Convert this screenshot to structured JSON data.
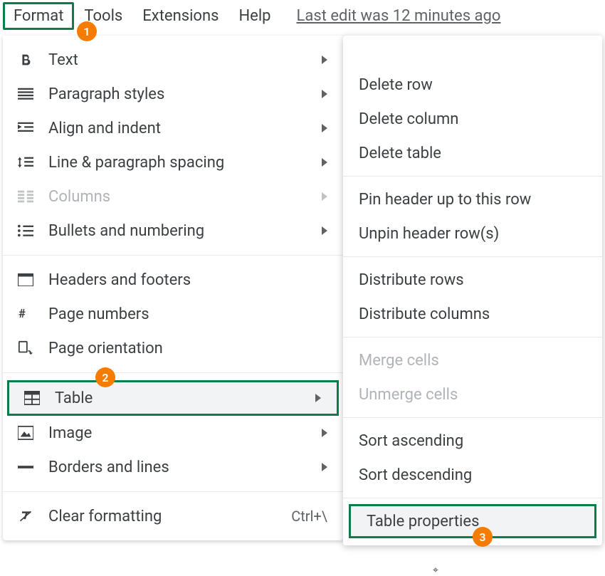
{
  "menubar": {
    "format": "Format",
    "tools": "Tools",
    "extensions": "Extensions",
    "help": "Help",
    "last_edit": "Last edit was 12 minutes ago"
  },
  "format_menu": {
    "text": "Text",
    "paragraph_styles": "Paragraph styles",
    "align_indent": "Align and indent",
    "line_spacing": "Line & paragraph spacing",
    "columns": "Columns",
    "bullets_numbering": "Bullets and numbering",
    "headers_footers": "Headers and footers",
    "page_numbers": "Page numbers",
    "page_orientation": "Page orientation",
    "table": "Table",
    "image": "Image",
    "borders_lines": "Borders and lines",
    "clear_formatting": "Clear formatting",
    "clear_formatting_shortcut": "Ctrl+\\"
  },
  "table_submenu": {
    "delete_row": "Delete row",
    "delete_column": "Delete column",
    "delete_table": "Delete table",
    "pin_header": "Pin header up to this row",
    "unpin_header": "Unpin header row(s)",
    "distribute_rows": "Distribute rows",
    "distribute_columns": "Distribute columns",
    "merge_cells": "Merge cells",
    "unmerge_cells": "Unmerge cells",
    "sort_asc": "Sort ascending",
    "sort_desc": "Sort descending",
    "table_properties": "Table properties"
  },
  "annotations": {
    "badge1": "1",
    "badge2": "2",
    "badge3": "3"
  }
}
